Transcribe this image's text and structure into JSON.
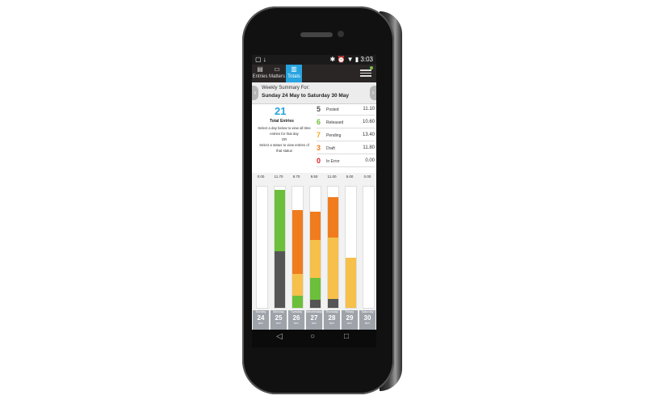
{
  "status": {
    "left_icons": "▢ ↓",
    "right_icons": "✱ ⏰ ▼ ▮",
    "time": "3:03"
  },
  "tabs": [
    {
      "label": "Entries",
      "icon": "entries-icon",
      "active": false
    },
    {
      "label": "Matters",
      "icon": "matters-icon",
      "active": false
    },
    {
      "label": "Totals",
      "icon": "totals-icon",
      "active": true
    }
  ],
  "week": {
    "heading": "Weekly Summary For:",
    "range": "Sunday 24 May to Saturday 30 May"
  },
  "summary": {
    "total_entries": "21",
    "total_label": "Total Entries",
    "help_lines": [
      "Select a day below to view all time",
      "entries for that day",
      "OR",
      "Select a status to view entries of",
      "that status"
    ],
    "statuses": [
      {
        "count": "5",
        "label": "Posted",
        "value": "11.10",
        "color": "#555555"
      },
      {
        "count": "6",
        "label": "Released",
        "value": "10.60",
        "color": "#6cbf3a"
      },
      {
        "count": "7",
        "label": "Pending",
        "value": "13.40",
        "color": "#f6a623"
      },
      {
        "count": "3",
        "label": "Draft",
        "value": "11.80",
        "color": "#f07c1e"
      },
      {
        "count": "0",
        "label": "In Error",
        "value": "0.00",
        "color": "#e02020"
      }
    ]
  },
  "chart_data": {
    "type": "bar",
    "day_totals": [
      "0.00",
      "11.70",
      "9.70",
      "9.50",
      "11.00",
      "5.00",
      "0.00"
    ],
    "days": [
      {
        "name": "Sunday",
        "date": "24",
        "month": "MAY"
      },
      {
        "name": "Monday",
        "date": "25",
        "month": "MAY"
      },
      {
        "name": "Tuesday",
        "date": "26",
        "month": "MAY"
      },
      {
        "name": "Wednesday",
        "date": "27",
        "month": "MAY"
      },
      {
        "name": "Thursday",
        "date": "28",
        "month": "MAY"
      },
      {
        "name": "Friday",
        "date": "29",
        "month": "MAY"
      },
      {
        "name": "Saturday",
        "date": "30",
        "month": "MAY"
      }
    ],
    "ylim": [
      0,
      12
    ],
    "stacks": [
      [],
      [
        {
          "status": "Posted",
          "value": 5.6,
          "color": "#555555"
        },
        {
          "status": "Released",
          "value": 6.1,
          "color": "#6cbf3a"
        }
      ],
      [
        {
          "status": "Released",
          "value": 1.2,
          "color": "#6cbf3a"
        },
        {
          "status": "Pending",
          "value": 2.2,
          "color": "#f6c04a"
        },
        {
          "status": "Draft",
          "value": 6.3,
          "color": "#f07c1e"
        }
      ],
      [
        {
          "status": "Posted",
          "value": 0.8,
          "color": "#555555"
        },
        {
          "status": "Released",
          "value": 2.2,
          "color": "#6cbf3a"
        },
        {
          "status": "Pending",
          "value": 3.7,
          "color": "#f6c04a"
        },
        {
          "status": "Draft",
          "value": 2.8,
          "color": "#f07c1e"
        }
      ],
      [
        {
          "status": "Posted",
          "value": 0.9,
          "color": "#555555"
        },
        {
          "status": "Pending",
          "value": 6.1,
          "color": "#f6c04a"
        },
        {
          "status": "Draft",
          "value": 4.0,
          "color": "#f07c1e"
        }
      ],
      [
        {
          "status": "Pending",
          "value": 5.0,
          "color": "#f6c04a"
        }
      ],
      []
    ]
  },
  "navbar": {
    "back": "◁",
    "home": "○",
    "recents": "□"
  }
}
